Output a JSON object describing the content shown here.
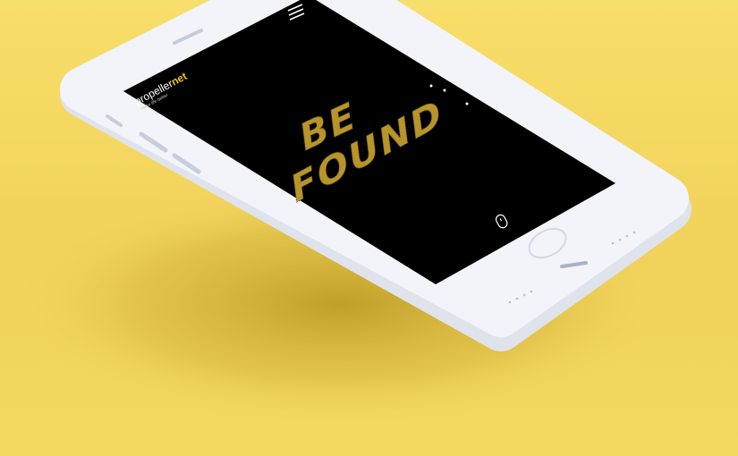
{
  "brand": {
    "name_part1": "propeller",
    "name_part2": "net",
    "tagline": "make life better"
  },
  "hero": {
    "line1": "BE",
    "line2": "FOUND"
  },
  "colors": {
    "background": "#f6dc66",
    "shadow": "#c9a82a",
    "phone_body": "#eef0f6",
    "screen": "#000000",
    "accent": "#e8c21a",
    "glitter": "#b8952a"
  },
  "icons": {
    "menu": "hamburger-menu-icon",
    "scroll": "mouse-scroll-icon",
    "pager": "pager-dots"
  }
}
